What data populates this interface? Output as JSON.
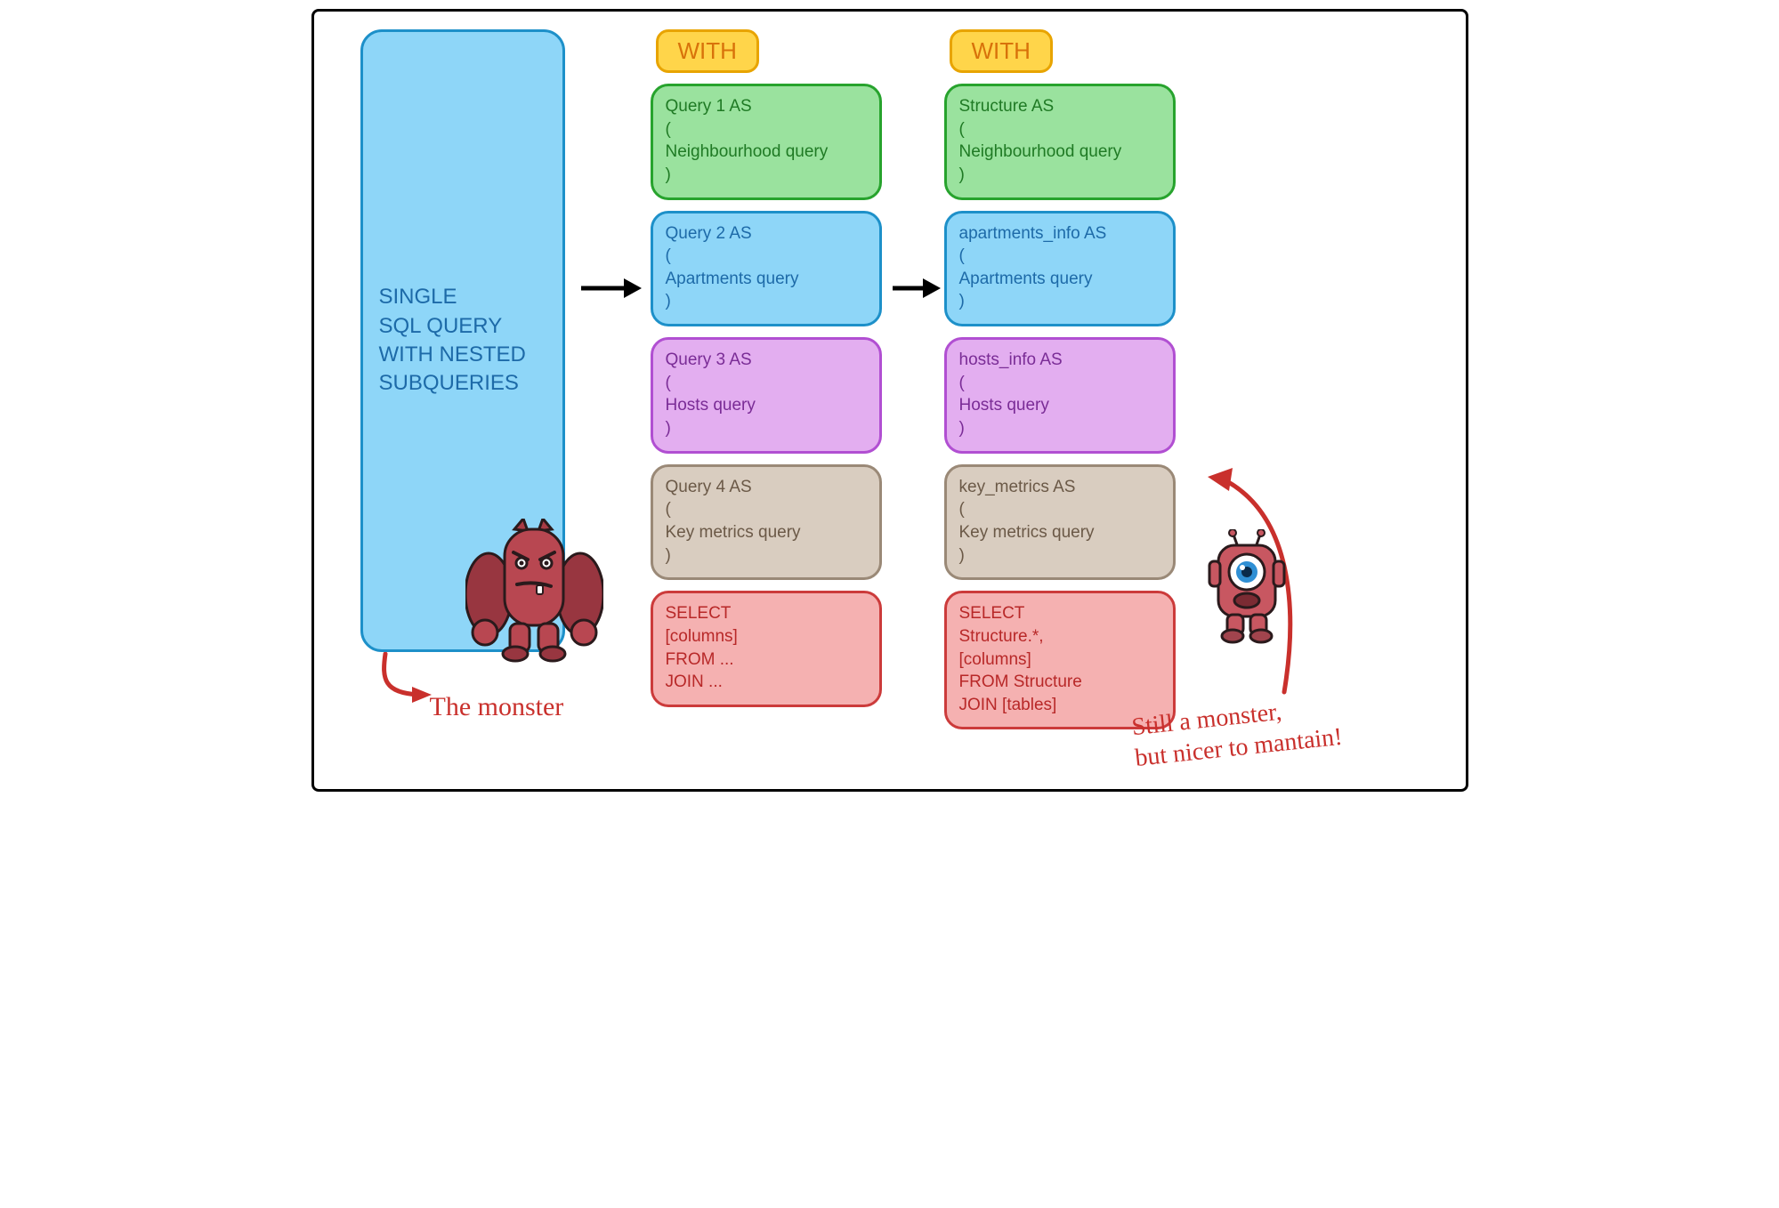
{
  "single_query": "SINGLE\nSQL QUERY\nWITH NESTED\nSUBQUERIES",
  "col2": {
    "with": "WITH",
    "green": "Query 1 AS\n(\nNeighbourhood query\n)",
    "blue": "Query 2 AS\n(\nApartments query\n)",
    "purple": "Query 3 AS\n(\nHosts query\n)",
    "tan": "Query 4 AS\n(\nKey metrics query\n)",
    "red": "SELECT\n   [columns]\nFROM ...\nJOIN ..."
  },
  "col3": {
    "with": "WITH",
    "green": "Structure AS\n(\nNeighbourhood query\n)",
    "blue": "apartments_info AS\n(\nApartments query\n)",
    "purple": "hosts_info AS\n(\nHosts query\n)",
    "tan": "key_metrics AS\n(\nKey metrics query\n)",
    "red": "SELECT\n   Structure.*,\n   [columns]\nFROM Structure\nJOIN [tables]"
  },
  "captions": {
    "monster": "The monster",
    "nicer": "Still a monster,\nbut nicer to mantain!"
  },
  "colors": {
    "accent_red": "#c9302c",
    "frame": "#000000"
  },
  "icons": {
    "arrow1": "right-arrow",
    "arrow2": "right-arrow",
    "curve_left": "curved-arrow",
    "curve_right": "curved-arrow",
    "monster_big": "angry-monster-icon",
    "monster_small": "cute-monster-icon"
  }
}
